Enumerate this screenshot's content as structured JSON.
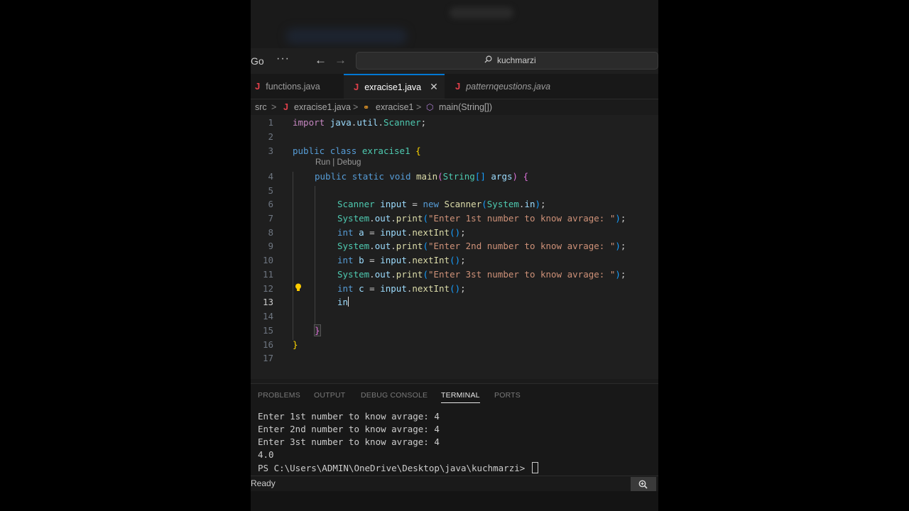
{
  "titlebar": {
    "menu_go": "Go",
    "more": "···",
    "back_arrow": "←",
    "forward_arrow": "→",
    "search_text": "kuchmarzi"
  },
  "tabs": [
    {
      "icon": "J",
      "label": "functions.java",
      "active": false
    },
    {
      "icon": "J",
      "label": "exracise1.java",
      "active": true,
      "close": "✕"
    },
    {
      "icon": "J",
      "label": "patternqeustions.java",
      "active": false
    }
  ],
  "breadcrumb": {
    "src": "src",
    "sep": ">",
    "file": "exracise1.java",
    "class": "exracise1",
    "method": "main(String[])"
  },
  "editor": {
    "line_numbers": [
      "1",
      "2",
      "3",
      "4",
      "5",
      "6",
      "7",
      "8",
      "9",
      "10",
      "11",
      "12",
      "13",
      "14",
      "15",
      "16",
      "17"
    ],
    "current_line": "13",
    "codelens": "Run | Debug",
    "lines": [
      "import java.util.Scanner;",
      "",
      "public class exracise1 {",
      "public static void main(String[] args) {",
      "",
      "Scanner input = new Scanner(System.in);",
      "System.out.print(\"Enter 1st number to know avrage: \");",
      "int a = input.nextInt();",
      "System.out.print(\"Enter 2nd number to know avrage: \");",
      "int b = input.nextInt();",
      "System.out.print(\"Enter 3st number to know avrage: \");",
      "int c = input.nextInt();",
      "in",
      "",
      "}",
      "}",
      ""
    ]
  },
  "panel": {
    "tabs": [
      "PROBLEMS",
      "OUTPUT",
      "DEBUG CONSOLE",
      "TERMINAL",
      "PORTS"
    ],
    "active_tab": "TERMINAL",
    "terminal_lines": [
      "Enter 1st number to know avrage: 4",
      "Enter 2nd number to know avrage: 4",
      "Enter 3st number to know avrage: 4",
      "4.0",
      "PS C:\\Users\\ADMIN\\OneDrive\\Desktop\\java\\kuchmarzi> "
    ]
  },
  "status": {
    "text": "Ready"
  },
  "colors": {
    "accent": "#0078d4",
    "java_icon": "#e0404a",
    "editor_bg": "#1f1f1f"
  }
}
